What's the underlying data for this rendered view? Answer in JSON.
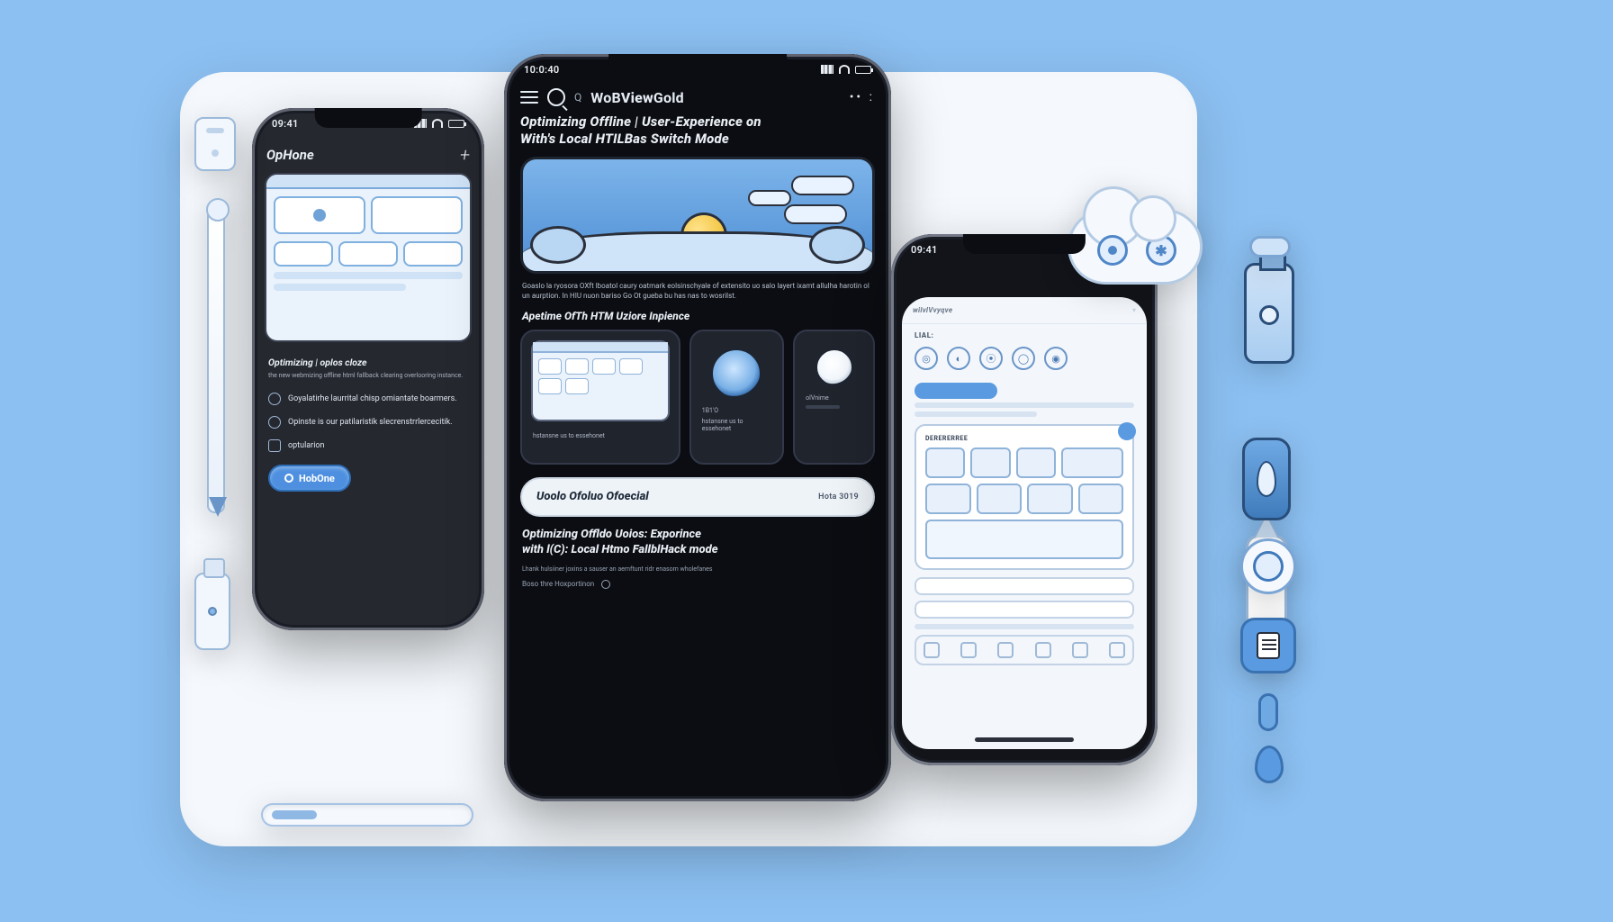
{
  "phone_left": {
    "status_time": "09:41",
    "topbar_title": "OpHone",
    "topbar_plus": "+",
    "section_title": "Optimizing | oplos cloze",
    "section_body": "the new webmizing offline html fallback clearing overlooring instance.",
    "items": [
      "Goyalatirhe laurrital chisp omiantate boarmers.",
      "Opinste is our patilaristik slecrenstrrlercecitik.",
      "optularion"
    ],
    "cta_label": "HobOne"
  },
  "phone_center": {
    "status_time": "10:0:40",
    "brand_prefix": "WoB",
    "brand_mid": "View",
    "brand_suffix": "Gold",
    "search_placeholder": "Q",
    "title_line1": "Optimizing Offline | User-Experience on",
    "title_line2": "With's Local HTILBas Switch Mode",
    "subtitle": "Goaslo la ryosora OXft lboatol caury oatmark eolsinschyale of extensito uo salo layert ixamt allulha harotin ol un aurption. In HIU nuon bariso Go Ot gueba bu has nas to wosrilst.",
    "h2": "Apetime OfTh HTM Uziore Inpience",
    "panel_badge": "1B1'O",
    "panel_meta_a": "hstansne us to essehonet",
    "panel_meta_b": "olVnime",
    "sep_label": "Uoolo Ofoluo Ofoecial",
    "sep_time": "Hota 3019",
    "h3_line1": "Optimizing Offldo Uoios: Exporince",
    "h3_line2": "with l(C): Local Htmo FallblHack mode",
    "foot_a": "Lhank hulsiiner joxins a sauser an aemftunt ridr enasom wholefanes",
    "foot_b": "Boso thre Hoxportinon"
  },
  "phone_right": {
    "crumb": "wilvlVvyqve",
    "section_label": "LIAL:",
    "card_label": "DERERERREE"
  }
}
